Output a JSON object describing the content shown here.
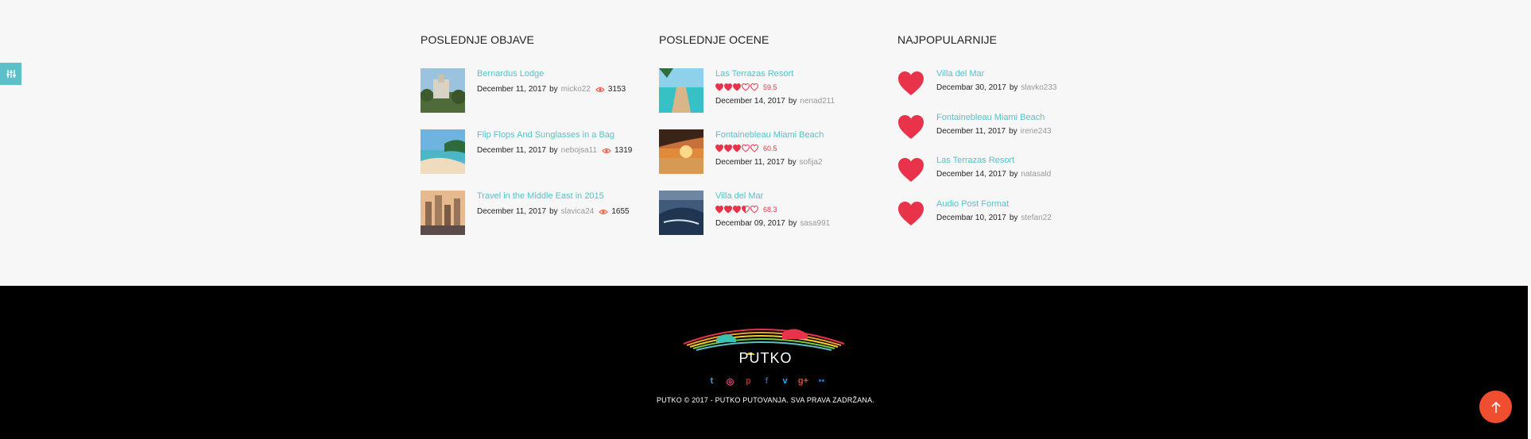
{
  "columns": {
    "latest_posts": {
      "title": "POSLEDNJE OBJAVE",
      "items": [
        {
          "title": "Bernardus Lodge",
          "date": "December 11, 2017",
          "by": "by",
          "author": "micko22",
          "views": "3153"
        },
        {
          "title": "Flip Flops And Sunglasses in a Bag",
          "date": "December 11, 2017",
          "by": "by",
          "author": "nebojsa11",
          "views": "1319"
        },
        {
          "title": "Travel in the Middle East in 2015",
          "date": "December 11, 2017",
          "by": "by",
          "author": "slavica24",
          "views": "1655"
        }
      ]
    },
    "latest_ratings": {
      "title": "POSLEDNJE OCENE",
      "items": [
        {
          "title": "Las Terrazas Resort",
          "rating": 3,
          "score": "59.5",
          "date": "December 14, 2017",
          "by": "by",
          "author": "nenad211"
        },
        {
          "title": "Fontainebleau Miami Beach",
          "rating": 3,
          "score": "60.5",
          "date": "December 11, 2017",
          "by": "by",
          "author": "sofija2"
        },
        {
          "title": "Villa del Mar",
          "rating": 3.5,
          "score": "68.3",
          "date": "Decembar 09, 2017",
          "by": "by",
          "author": "sasa991"
        }
      ]
    },
    "most_popular": {
      "title": "NAJPOPULARNIJE",
      "items": [
        {
          "title": "Villa del Mar",
          "date": "Decembar 30, 2017",
          "by": "by",
          "author": "slavko233"
        },
        {
          "title": "Fontainebleau Miami Beach",
          "date": "December 11, 2017",
          "by": "by",
          "author": "irene243"
        },
        {
          "title": "Las Terrazas Resort",
          "date": "December 14, 2017",
          "by": "by",
          "author": "natasald"
        },
        {
          "title": "Audio Post Format",
          "date": "Decembar 10, 2017",
          "by": "by",
          "author": "stefan22"
        }
      ]
    }
  },
  "footer": {
    "brand": "PUTKO",
    "copyright": "PUTKO © 2017 - PUTKO PUTOVANJA. SVA PRAVA ZADRŽANA.",
    "social": [
      {
        "icon": "twitter-icon",
        "glyph": "t",
        "color": "#2aa9e0"
      },
      {
        "icon": "dribbble-icon",
        "glyph": "◎",
        "color": "#ea4c89"
      },
      {
        "icon": "pinterest-icon",
        "glyph": "p",
        "color": "#cb2027"
      },
      {
        "icon": "facebook-icon",
        "glyph": "f",
        "color": "#3b5998"
      },
      {
        "icon": "vimeo-icon",
        "glyph": "v",
        "color": "#1ab7ea"
      },
      {
        "icon": "google-plus-icon",
        "glyph": "g+",
        "color": "#dd4b39"
      },
      {
        "icon": "flickr-icon",
        "glyph": "••",
        "color": "#1e74d5"
      }
    ]
  },
  "colors": {
    "accent": "#5bc0c8",
    "heart": "#e8334a",
    "to_top": "#f04e30"
  }
}
